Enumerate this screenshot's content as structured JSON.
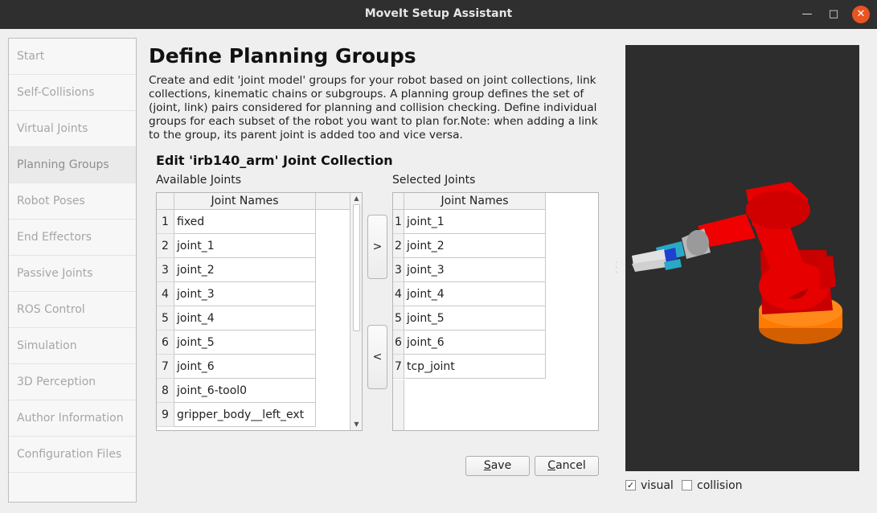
{
  "window": {
    "title": "MoveIt Setup Assistant"
  },
  "sidebar": {
    "items": [
      {
        "label": "Start"
      },
      {
        "label": "Self-Collisions"
      },
      {
        "label": "Virtual Joints"
      },
      {
        "label": "Planning Groups"
      },
      {
        "label": "Robot Poses"
      },
      {
        "label": "End Effectors"
      },
      {
        "label": "Passive Joints"
      },
      {
        "label": "ROS Control"
      },
      {
        "label": "Simulation"
      },
      {
        "label": "3D Perception"
      },
      {
        "label": "Author Information"
      },
      {
        "label": "Configuration Files"
      }
    ]
  },
  "main": {
    "title": "Define Planning Groups",
    "description_lines": [
      "Create and edit 'joint model' groups for your robot based on joint collections, link",
      "collections, kinematic chains or subgroups. A planning group defines the set of",
      "(joint, link) pairs considered for planning and collision checking. Define individual",
      "groups for each subset of the robot you want to plan for.Note: when adding a link",
      "to the group, its parent joint is added too and vice versa."
    ],
    "section_title": "Edit 'irb140_arm' Joint Collection",
    "available": {
      "label": "Available Joints",
      "header": "Joint Names",
      "rows": [
        {
          "num": "1",
          "name": "fixed"
        },
        {
          "num": "2",
          "name": "joint_1"
        },
        {
          "num": "3",
          "name": "joint_2"
        },
        {
          "num": "4",
          "name": "joint_3"
        },
        {
          "num": "5",
          "name": "joint_4"
        },
        {
          "num": "6",
          "name": "joint_5"
        },
        {
          "num": "7",
          "name": "joint_6"
        },
        {
          "num": "8",
          "name": "joint_6-tool0"
        },
        {
          "num": "9",
          "name": "gripper_body__left_ext"
        }
      ]
    },
    "selected": {
      "label": "Selected Joints",
      "header": "Joint Names",
      "rows": [
        {
          "num": "1",
          "name": "joint_1"
        },
        {
          "num": "2",
          "name": "joint_2"
        },
        {
          "num": "3",
          "name": "joint_3"
        },
        {
          "num": "4",
          "name": "joint_4"
        },
        {
          "num": "5",
          "name": "joint_5"
        },
        {
          "num": "6",
          "name": "joint_6"
        },
        {
          "num": "7",
          "name": "tcp_joint"
        }
      ]
    },
    "add_button": ">",
    "remove_button": "<",
    "save_button": "Save",
    "save_mnemonic": "S",
    "save_rest": "ave",
    "cancel_button": "Cancel",
    "cancel_mnemonic": "C",
    "cancel_rest": "ancel"
  },
  "viewer": {
    "visual_label": "visual",
    "visual_checked": true,
    "collision_label": "collision",
    "collision_checked": false,
    "check_glyph": "✓"
  },
  "icons": {
    "minimize": "minimize-icon",
    "maximize": "maximize-icon",
    "close": "close-icon",
    "scroll_up": "scroll-up-arrow-icon",
    "scroll_down": "scroll-down-arrow-icon"
  },
  "colors": {
    "titlebar": "#2f2f2f",
    "close_button": "#e95420",
    "viewer_background": "#2d2d2d",
    "robot_body": "#e60000",
    "robot_base": "#ff7a00"
  }
}
